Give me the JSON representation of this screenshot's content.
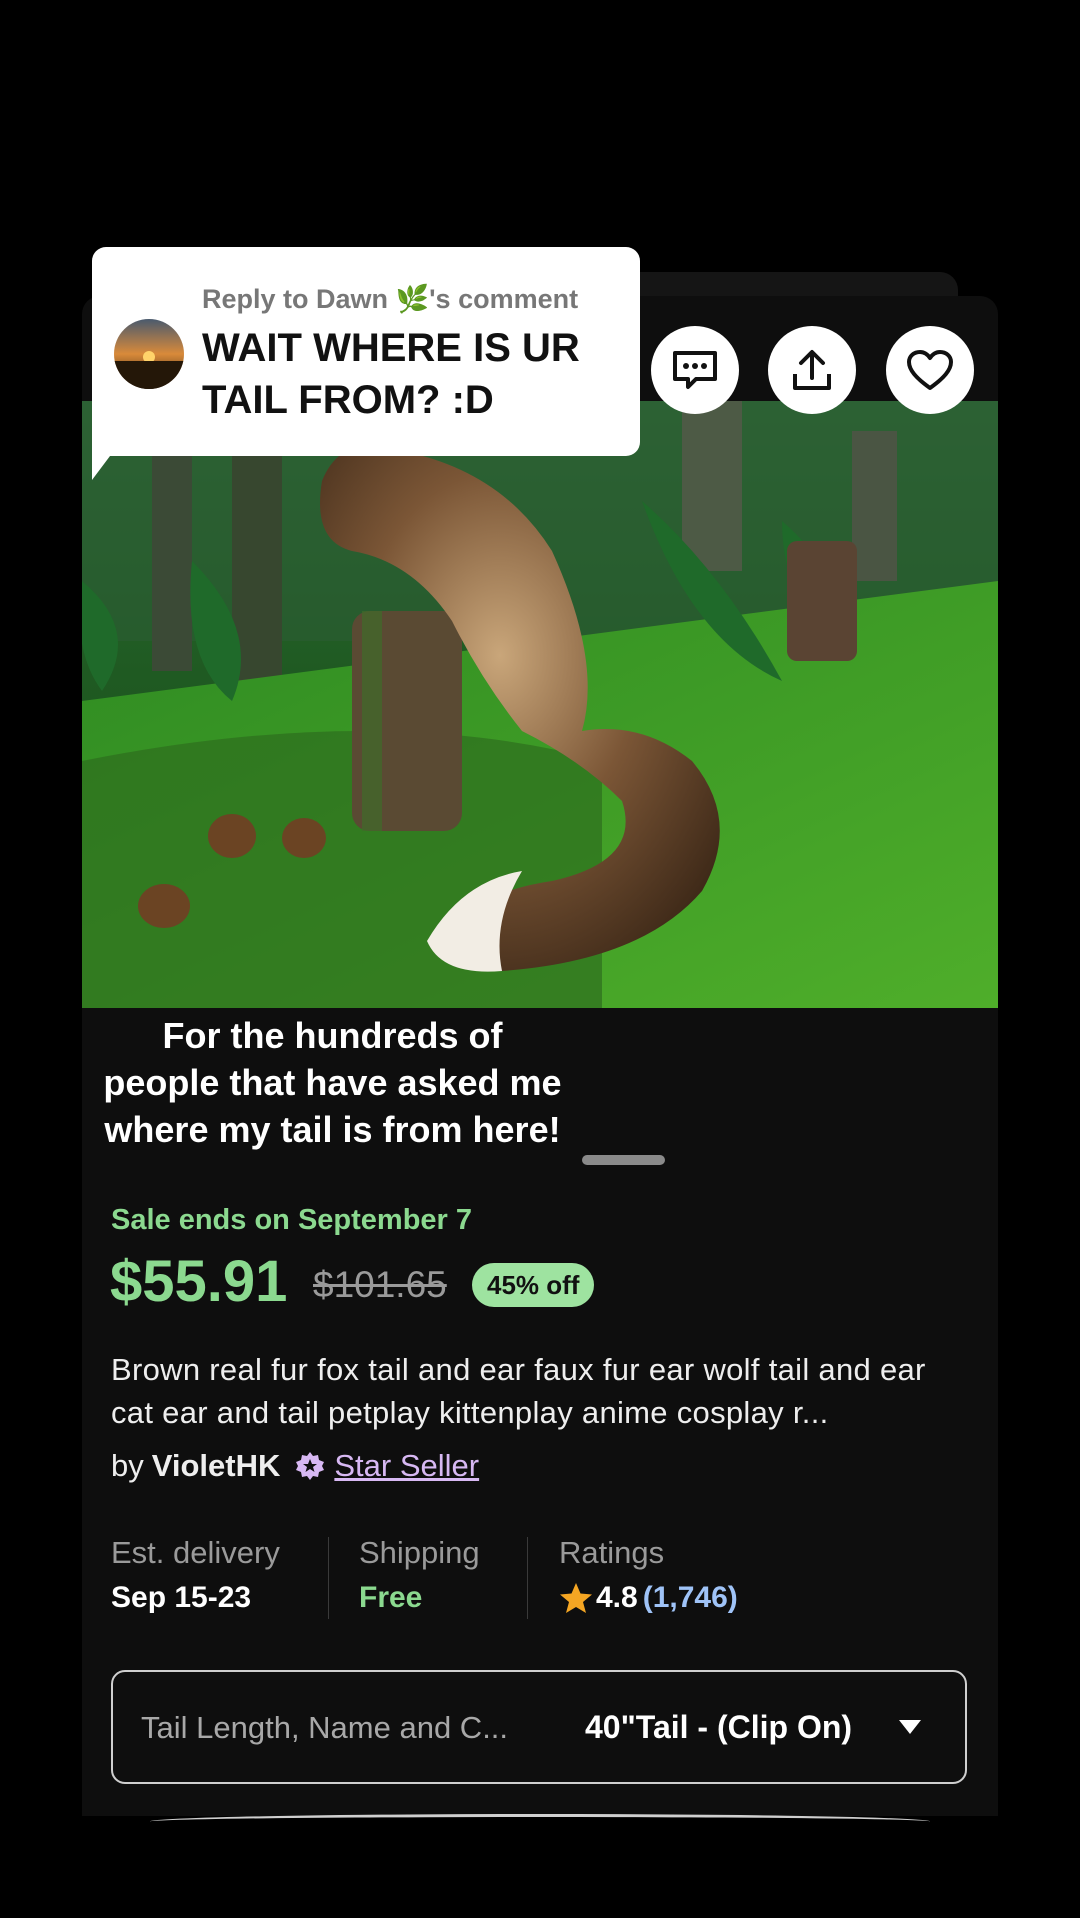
{
  "reply": {
    "reply_to": "Reply to Dawn 🌿's comment",
    "comment": "WAIT WHERE IS UR TAIL FROM? :D"
  },
  "caption": "For the hundreds of people that have asked me where my tail is from here!",
  "listing": {
    "sale_ends": "Sale ends on September 7",
    "price": "$55.91",
    "old_price": "$101.65",
    "discount": "45% off",
    "title": "Brown real fur fox tail and ear faux fur ear wolf tail and ear cat ear and tail petplay kittenplay anime cosplay r...",
    "by": "by",
    "seller": "VioletHK",
    "badge": "Star Seller"
  },
  "stats": {
    "delivery_label": "Est. delivery",
    "delivery_value": "Sep 15-23",
    "shipping_label": "Shipping",
    "shipping_value": "Free",
    "ratings_label": "Ratings",
    "rating": "4.8",
    "rating_count": "(1,746)"
  },
  "variant": {
    "label": "Tail Length, Name and C...",
    "value": "40\"Tail - (Clip On)"
  },
  "icons": [
    "message-icon",
    "share-icon",
    "heart-icon",
    "star-seller-icon",
    "star-icon",
    "chevron-down-icon"
  ],
  "colors": {
    "sale_green": "#8bd98f",
    "discount_bg": "#9ee3a0",
    "star_seller_purple": "#d7b8f3",
    "rating_count_blue": "#9fc3f7",
    "star_orange": "#f5a623"
  }
}
